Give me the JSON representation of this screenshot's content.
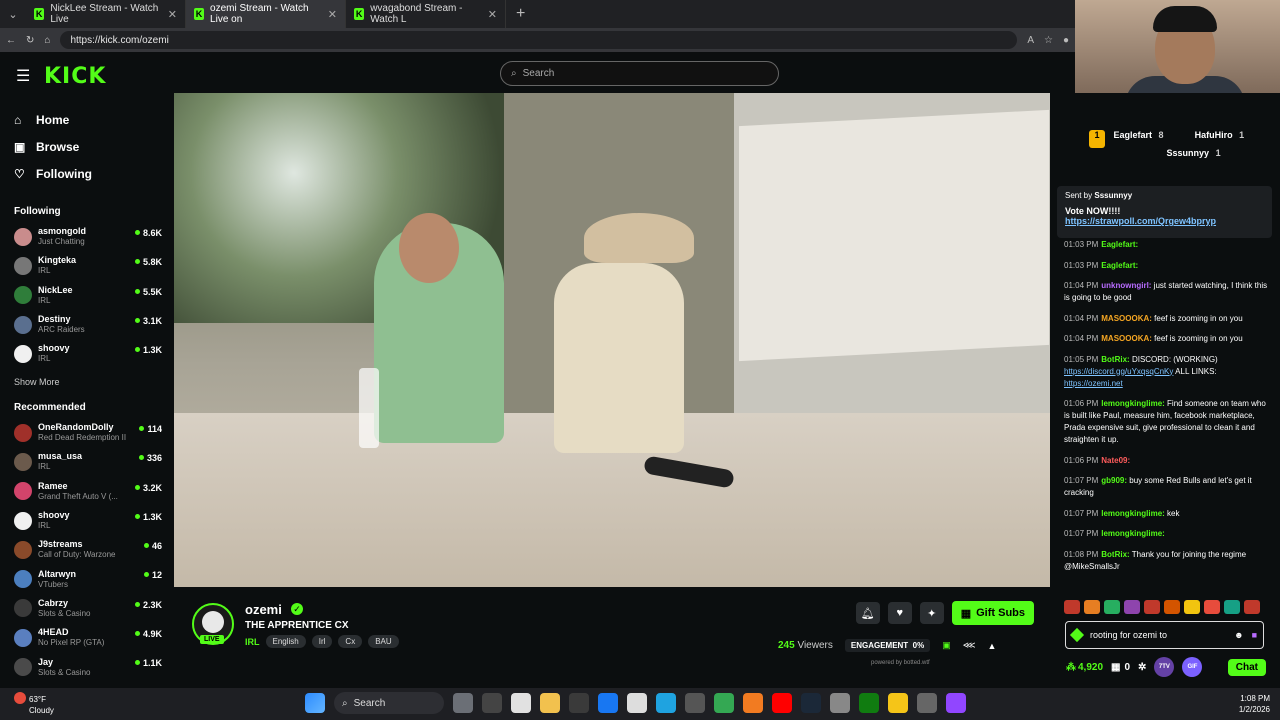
{
  "browser": {
    "tabs": [
      {
        "title": "NickLee Stream - Watch Live"
      },
      {
        "title": "ozemi Stream - Watch Live on"
      },
      {
        "title": "wvagabond Stream - Watch L"
      }
    ],
    "url": "https://kick.com/ozemi"
  },
  "site": {
    "logo": "KICK",
    "search_placeholder": "Search"
  },
  "nav": [
    {
      "label": "Home",
      "icon": "home-icon"
    },
    {
      "label": "Browse",
      "icon": "browse-icon"
    },
    {
      "label": "Following",
      "icon": "heart-icon"
    }
  ],
  "following_header": "Following",
  "following": [
    {
      "name": "asmongold",
      "cat": "Just Chatting",
      "viewers": "8.6K",
      "color": "#c98c8c"
    },
    {
      "name": "Kingteka",
      "cat": "IRL",
      "viewers": "5.8K",
      "color": "#777"
    },
    {
      "name": "NickLee",
      "cat": "IRL",
      "viewers": "5.5K",
      "color": "#2f7d3a"
    },
    {
      "name": "Destiny",
      "cat": "ARC Raiders",
      "viewers": "3.1K",
      "color": "#5a6f8f"
    },
    {
      "name": "shoovy",
      "cat": "IRL",
      "viewers": "1.3K",
      "color": "#f0f0f0"
    }
  ],
  "show_more": "Show More",
  "recommended_header": "Recommended",
  "recommended": [
    {
      "name": "OneRandomDolly",
      "cat": "Red Dead Redemption II",
      "viewers": "114",
      "color": "#a0302a"
    },
    {
      "name": "musa_usa",
      "cat": "IRL",
      "viewers": "336",
      "color": "#6b5a4c"
    },
    {
      "name": "Ramee",
      "cat": "Grand Theft Auto V (...",
      "viewers": "3.2K",
      "color": "#d2446b"
    },
    {
      "name": "shoovy",
      "cat": "IRL",
      "viewers": "1.3K",
      "color": "#f0f0f0"
    },
    {
      "name": "J9streams",
      "cat": "Call of Duty: Warzone",
      "viewers": "46",
      "color": "#8a4a2a"
    },
    {
      "name": "Altarwyn",
      "cat": "VTubers",
      "viewers": "12",
      "color": "#4c7fbf"
    },
    {
      "name": "Cabrzy",
      "cat": "Slots & Casino",
      "viewers": "2.3K",
      "color": "#3a3a3a"
    },
    {
      "name": "4HEAD",
      "cat": "No Pixel RP (GTA)",
      "viewers": "4.9K",
      "color": "#5a7fbf"
    },
    {
      "name": "Jay",
      "cat": "Slots & Casino",
      "viewers": "1.1K",
      "color": "#4a4a4a"
    }
  ],
  "stream": {
    "live_badge": "LIVE",
    "streamer": "ozemi",
    "title": "THE APPRENTICE CX",
    "category": "IRL",
    "tags": [
      "English",
      "Irl",
      "Cx",
      "BAU"
    ],
    "gift_label": "Gift Subs",
    "viewers": "245",
    "viewers_label": "Viewers",
    "engagement_label": "ENGAGEMENT",
    "engagement_value": "0%",
    "powered_by": "powered by botted.wtf"
  },
  "chat": {
    "leaders": [
      {
        "name": "Eaglefart",
        "count": "8"
      },
      {
        "name": "HafuHiro",
        "count": "1"
      },
      {
        "name": "Sssunnyy",
        "count": "1"
      }
    ],
    "pinned_by_label": "Sent by",
    "pinned_by": "Sssunnyy",
    "pinned_text": "Vote NOW!!!!",
    "pinned_link": "https://strawpoll.com/Qrgew4bpryp",
    "messages": [
      {
        "time": "01:03 PM",
        "user": "Eaglefart:",
        "text": "",
        "color": "#53fc18"
      },
      {
        "time": "01:03 PM",
        "user": "Eaglefart:",
        "text": "",
        "color": "#53fc18"
      },
      {
        "time": "01:04 PM",
        "user": "unknowngirl:",
        "text": "just started watching, I think this is going to be good",
        "color": "#b86cff"
      },
      {
        "time": "01:04 PM",
        "user": "MASOOOKA:",
        "text": "feef is zooming in on you",
        "color": "#f5a623"
      },
      {
        "time": "01:04 PM",
        "user": "MASOOOKA:",
        "text": "feef is zooming in on you",
        "color": "#f5a623"
      },
      {
        "time": "01:05 PM",
        "user": "BotRix:",
        "text": "DISCORD: (WORKING)",
        "link": "https://discord.gg/uYxqsqCnKy",
        "text2": "ALL LINKS:",
        "link2": "https://ozemi.net",
        "color": "#53fc18"
      },
      {
        "time": "01:06 PM",
        "user": "lemongkinglime:",
        "text": "Find someone on team who is built like Paul, measure him, facebook marketplace, Prada expensive suit, give professional to clean it and straighten it up.",
        "color": "#53fc18"
      },
      {
        "time": "01:06 PM",
        "user": "Nate09:",
        "text": "",
        "color": "#ff5c5c"
      },
      {
        "time": "01:07 PM",
        "user": "gb909:",
        "text": "buy some Red Bulls and let's get it cracking",
        "color": "#53fc18"
      },
      {
        "time": "01:07 PM",
        "user": "lemongkinglime:",
        "text": "kek",
        "color": "#53fc18"
      },
      {
        "time": "01:07 PM",
        "user": "lemongkinglime:",
        "text": "",
        "color": "#53fc18"
      },
      {
        "time": "01:08 PM",
        "user": "BotRix:",
        "text": "Thank you for joining the regime @MikeSmallsJr",
        "color": "#53fc18"
      }
    ],
    "input_value": "rooting for ozemi to",
    "points": "4,920",
    "zero": "0",
    "chat_btn": "Chat"
  },
  "taskbar": {
    "temp": "63°F",
    "weather": "Cloudy",
    "search": "Search",
    "time": "1:08 PM",
    "date": "1/2/2026"
  }
}
